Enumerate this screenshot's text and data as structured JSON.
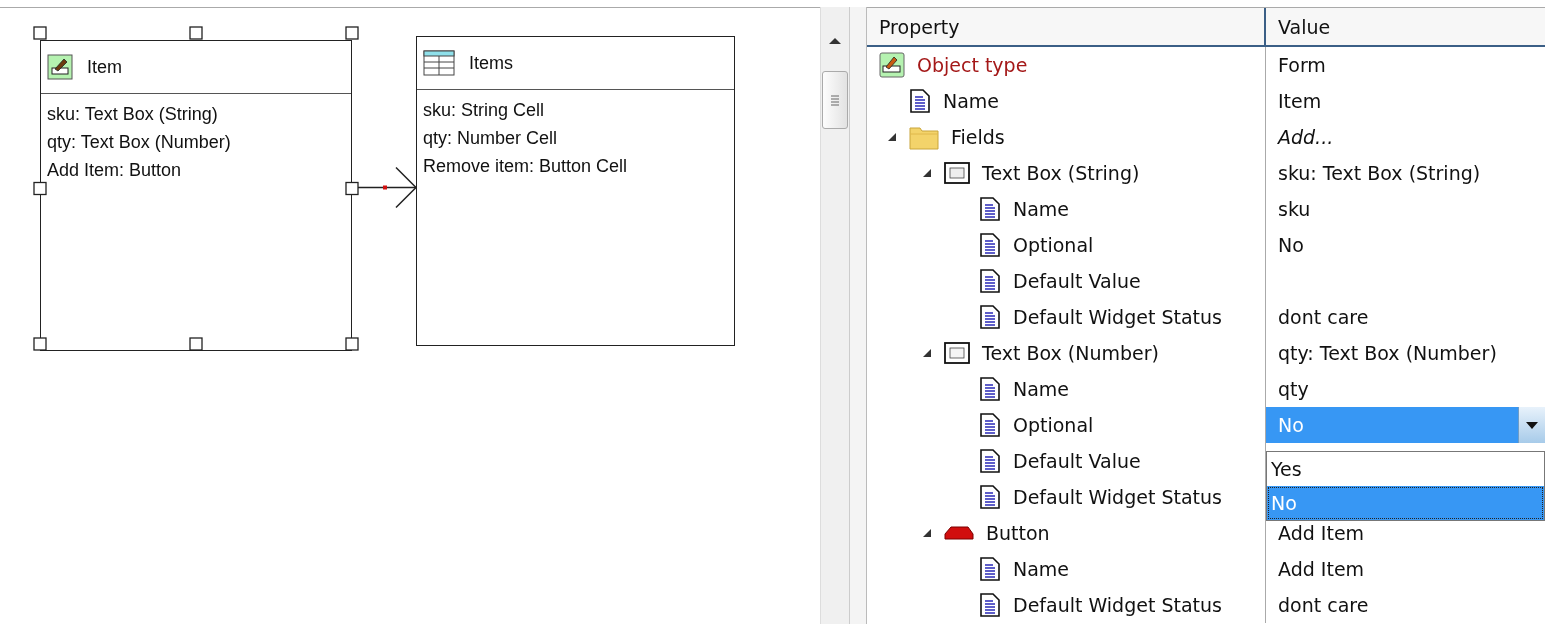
{
  "diagram": {
    "nodes": [
      {
        "title": "Item",
        "kind": "form",
        "selected": true,
        "fields": [
          "sku: Text Box (String)",
          "qty: Text Box (Number)",
          "Add Item: Button"
        ]
      },
      {
        "title": "Items",
        "kind": "table",
        "selected": false,
        "fields": [
          "sku: String Cell",
          "qty: Number Cell",
          "Remove item: Button Cell"
        ]
      }
    ]
  },
  "properties": {
    "columns": [
      "Property",
      "Value"
    ],
    "rows": [
      {
        "kind": "type",
        "label": "Object type",
        "value": "Form"
      },
      {
        "kind": "property",
        "label": "Name",
        "value": "Item"
      },
      {
        "kind": "collection",
        "label": "Fields",
        "value": "Add...",
        "expanded": true,
        "children": [
          {
            "kind": "text-string",
            "label": "Text Box (String)",
            "value": "sku: Text Box (String)",
            "expanded": true,
            "children": [
              {
                "kind": "property",
                "label": "Name",
                "value": "sku"
              },
              {
                "kind": "property",
                "label": "Optional",
                "value": "No"
              },
              {
                "kind": "property",
                "label": "Default Value"
              },
              {
                "kind": "property",
                "label": "Default Widget Status",
                "value": "dont care"
              }
            ]
          },
          {
            "kind": "text-number",
            "label": "Text Box (Number)",
            "value": "qty: Text Box (Number)",
            "expanded": true,
            "children": [
              {
                "kind": "property",
                "label": "Name",
                "value": "qty"
              },
              {
                "kind": "property",
                "label": "Optional",
                "dropdown": {
                  "value": "No",
                  "open": true,
                  "options": [
                    {
                      "label": "Yes",
                      "selected": false
                    },
                    {
                      "label": "No",
                      "selected": true
                    }
                  ]
                }
              },
              {
                "kind": "property",
                "label": "Default Value"
              },
              {
                "kind": "property",
                "label": "Default Widget Status"
              }
            ]
          },
          {
            "kind": "button",
            "label": "Button",
            "value": "Add Item",
            "expanded": true,
            "children": [
              {
                "kind": "property",
                "label": "Name",
                "value": "Add Item"
              },
              {
                "kind": "property",
                "label": "Default Widget Status",
                "value": "dont care"
              }
            ]
          }
        ]
      }
    ]
  }
}
